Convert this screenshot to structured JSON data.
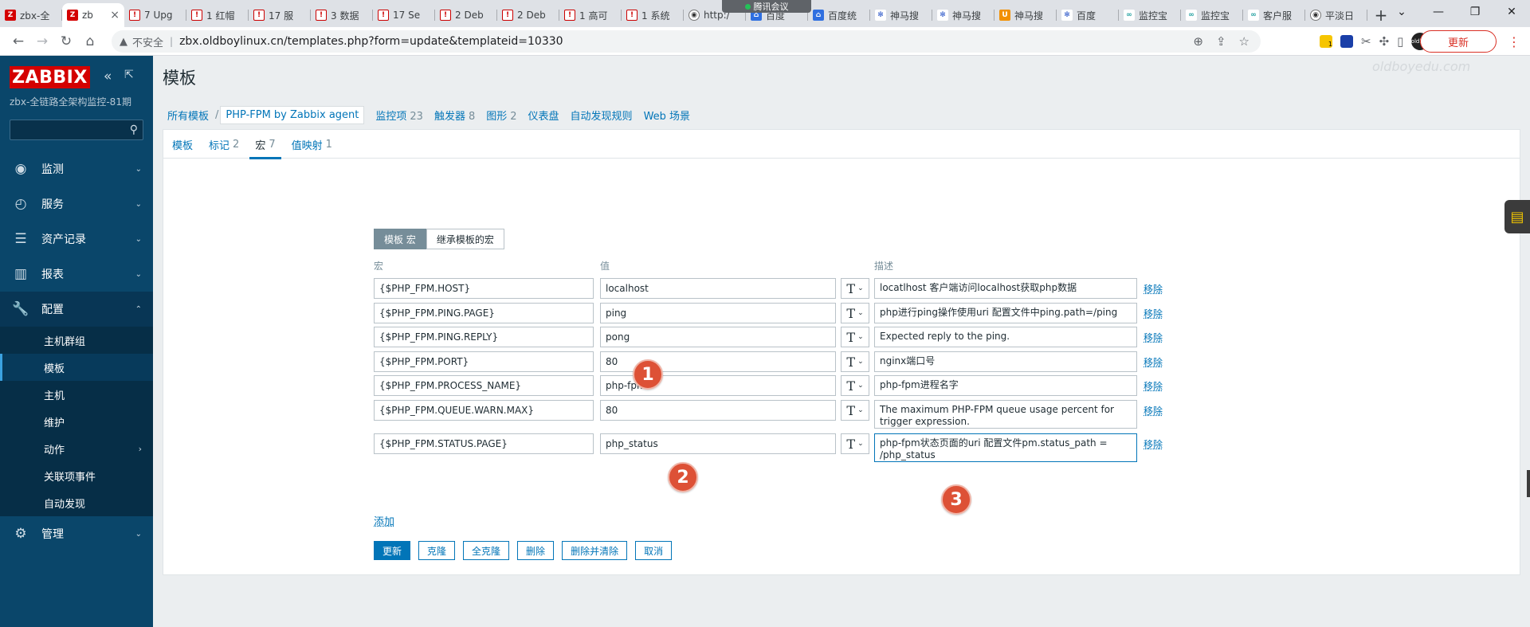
{
  "browser": {
    "tabs": [
      {
        "favicon": "Z",
        "kind": "z",
        "label": "zbx-全"
      },
      {
        "favicon": "Z",
        "kind": "z",
        "label": "zb",
        "active": true
      },
      {
        "favicon": "!",
        "kind": "r",
        "label": "7 Upg"
      },
      {
        "favicon": "!",
        "kind": "r",
        "label": "1 红帽"
      },
      {
        "favicon": "!",
        "kind": "r",
        "label": "17 服"
      },
      {
        "favicon": "!",
        "kind": "r",
        "label": "3 数据"
      },
      {
        "favicon": "!",
        "kind": "r",
        "label": "17 Se"
      },
      {
        "favicon": "!",
        "kind": "r",
        "label": "2 Deb"
      },
      {
        "favicon": "!",
        "kind": "r",
        "label": "2 Deb"
      },
      {
        "favicon": "!",
        "kind": "r",
        "label": "1 高可"
      },
      {
        "favicon": "!",
        "kind": "r",
        "label": "1 系统"
      },
      {
        "favicon": "◉",
        "kind": "g",
        "label": "http:/"
      },
      {
        "favicon": "⌂",
        "kind": "b",
        "label": "百度"
      },
      {
        "favicon": "⌂",
        "kind": "b",
        "label": "百度统"
      },
      {
        "favicon": "✻",
        "kind": "p",
        "label": "神马搜"
      },
      {
        "favicon": "✻",
        "kind": "p",
        "label": "神马搜"
      },
      {
        "favicon": "U",
        "kind": "o",
        "label": "神马搜"
      },
      {
        "favicon": "✻",
        "kind": "p",
        "label": "百度"
      },
      {
        "favicon": "∞",
        "kind": "t",
        "label": "监控宝"
      },
      {
        "favicon": "∞",
        "kind": "t",
        "label": "监控宝"
      },
      {
        "favicon": "∞",
        "kind": "t",
        "label": "客户服"
      },
      {
        "favicon": "◉",
        "kind": "g",
        "label": "平淡日"
      }
    ],
    "meeting_label": "腾讯会议",
    "insecure_label": "不安全",
    "url": "zbx.oldboylinux.cn/templates.php?form=update&templateid=10330",
    "update_label": "更新",
    "extension_badge": "1",
    "avatar_text": "oldboy"
  },
  "sidebar": {
    "logo": "ZABBIX",
    "server_name": "zbx-全链路全架构监控-81期",
    "search_placeholder": "",
    "menu": [
      {
        "icon": "eye-icon",
        "label": "监测"
      },
      {
        "icon": "stopwatch-icon",
        "label": "服务"
      },
      {
        "icon": "list-icon",
        "label": "资产记录"
      },
      {
        "icon": "bar-chart-icon",
        "label": "报表"
      },
      {
        "icon": "wrench-icon",
        "label": "配置"
      }
    ],
    "config_submenu": [
      "主机群组",
      "模板",
      "主机",
      "维护",
      "动作",
      "关联项事件",
      "自动发现"
    ],
    "admin_label": "管理"
  },
  "page": {
    "title": "模板",
    "watermark": "oldboyedu.com"
  },
  "breadcrumbs": {
    "all_templates": "所有模板",
    "current": "PHP-FPM by Zabbix agent",
    "nav": [
      {
        "label": "监控项",
        "count": "23"
      },
      {
        "label": "触发器",
        "count": "8"
      },
      {
        "label": "图形",
        "count": "2"
      },
      {
        "label": "仪表盘",
        "count": ""
      },
      {
        "label": "自动发现规则",
        "count": ""
      },
      {
        "label": "Web 场景",
        "count": ""
      }
    ]
  },
  "form_tabs": [
    {
      "label": "模板",
      "count": ""
    },
    {
      "label": "标记",
      "count": "2"
    },
    {
      "label": "宏",
      "count": "7"
    },
    {
      "label": "值映射",
      "count": "1"
    }
  ],
  "macro_toggle": {
    "own": "模板 宏",
    "inherited": "继承模板的宏"
  },
  "columns": {
    "macro": "宏",
    "value": "值",
    "description": "描述"
  },
  "macros": [
    {
      "macro": "{$PHP_FPM.HOST}",
      "value": "localhost",
      "description": "locatlhost 客户端访问localhost获取php数据"
    },
    {
      "macro": "{$PHP_FPM.PING.PAGE}",
      "value": "ping",
      "description": "php进行ping操作使用uri    配置文件中ping.path=/ping"
    },
    {
      "macro": "{$PHP_FPM.PING.REPLY}",
      "value": "pong",
      "description": "Expected reply to the ping."
    },
    {
      "macro": "{$PHP_FPM.PORT}",
      "value": "80",
      "description": "nginx端口号"
    },
    {
      "macro": "{$PHP_FPM.PROCESS_NAME}",
      "value": "php-fpm",
      "description": "php-fpm进程名字"
    },
    {
      "macro": "{$PHP_FPM.QUEUE.WARN.MAX}",
      "value": "80",
      "description": "The maximum PHP-FPM queue usage percent for trigger expression."
    },
    {
      "macro": "{$PHP_FPM.STATUS.PAGE}",
      "value": "php_status",
      "description": "php-fpm状态页面的uri 配置文件pm.status_path =     /php_status"
    }
  ],
  "type_glyph": "T",
  "remove_label": "移除",
  "add_label": "添加",
  "buttons": {
    "update": "更新",
    "clone": "克隆",
    "full_clone": "全克隆",
    "delete": "删除",
    "delete_and_clear": "删除并清除",
    "cancel": "取消"
  },
  "annotations": [
    "1",
    "2",
    "3"
  ]
}
